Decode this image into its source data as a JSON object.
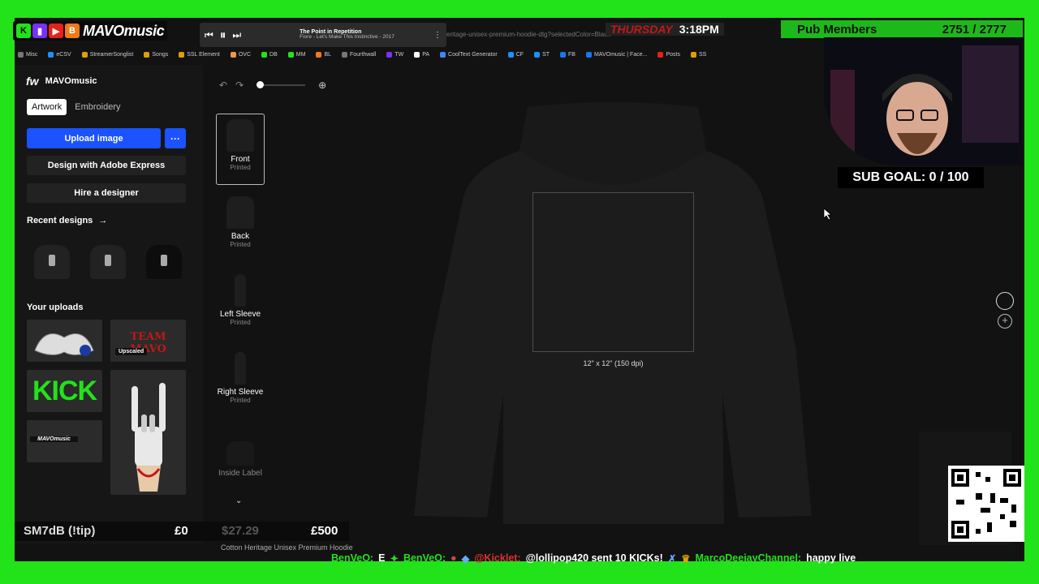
{
  "overlay": {
    "brand_name": "MAVOmusic",
    "player": {
      "track_title": "The Point in Repetition",
      "track_artist": "Fiore - Let's Make This Instinctive - 2017"
    },
    "url_fragment": "eritage-unisex-premium-hoodie-dtg?selectedColor=Black",
    "day": "THURSDAY",
    "time": "3:18PM",
    "pub_label": "Pub Members",
    "pub_count": "2751 / 2777",
    "sub_goal": "SUB GOAL: 0 / 100"
  },
  "bookmarks": [
    "Misc",
    "eCSV",
    "StreamerSonglist",
    "Songs",
    "SSL Element",
    "OVC",
    "DB",
    "MM",
    "BL",
    "Fourthwall",
    "TW",
    "PA",
    "CoolText Generator",
    "CF",
    "ST",
    "FB",
    "MAVOmusic | Face...",
    "Posts",
    "SS"
  ],
  "left": {
    "logo": "fw",
    "shop": "MAVOmusic",
    "tabs": [
      "Artwork",
      "Embroidery"
    ],
    "upload_label": "Upload image",
    "more_label": "···",
    "adobe_label": "Design with Adobe Express",
    "designer_label": "Hire a designer",
    "recent_label": "Recent designs",
    "uploads_label": "Your uploads",
    "upscaled_badge": "Upscaled",
    "kick_text": "KICK",
    "team_text": "TEAM MAVO"
  },
  "views": [
    {
      "label": "Front",
      "status": "Printed"
    },
    {
      "label": "Back",
      "status": "Printed"
    },
    {
      "label": "Left Sleeve",
      "status": "Printed"
    },
    {
      "label": "Right Sleeve",
      "status": "Printed"
    },
    {
      "label": "Inside Label",
      "status": ""
    }
  ],
  "canvas": {
    "print_size": "12\" x 12\" (150 dpi)"
  },
  "bottom": {
    "tip_name": "SM7dB (!tip)",
    "tip_min": "£0",
    "price": "$27.29",
    "tip_goal": "£500",
    "product_name": "Cotton Heritage Unisex Premium Hoodie",
    "ticker": {
      "n1": "BenVeO:",
      "t1": "E",
      "n2": "BenVeO:",
      "n3": "@Kicklet:",
      "t3": "@lollipop420 sent 10 KICKs!",
      "n4": "MarcoDeejayChannel:",
      "t4": "happy live"
    }
  },
  "colors": {
    "chroma": "#22e31a",
    "accent": "#1a53ff",
    "panel": "#161616",
    "canvas": "#121212"
  }
}
